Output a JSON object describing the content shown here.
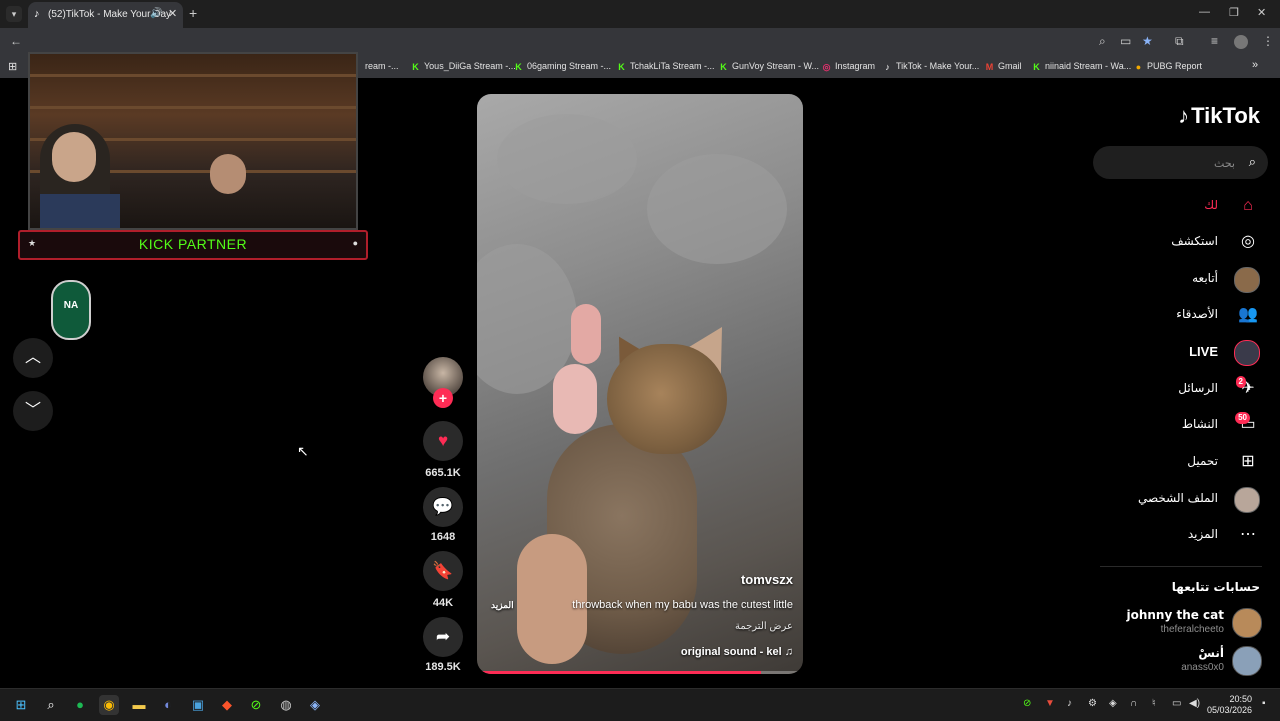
{
  "browser": {
    "tab_title": "(52)TikTok - Make Your Day",
    "new_tab": "+",
    "bookmarks": [
      {
        "label": "ream -...",
        "icon": "kick-icon"
      },
      {
        "label": "Yous_DiiGa Stream -...",
        "icon": "kick-icon"
      },
      {
        "label": "06gaming Stream -...",
        "icon": "kick-icon"
      },
      {
        "label": "TchakLiTa Stream -...",
        "icon": "kick-icon"
      },
      {
        "label": "GunVoy Stream - W...",
        "icon": "kick-icon"
      },
      {
        "label": "Instagram",
        "icon": "instagram-icon"
      },
      {
        "label": "TikTok - Make Your...",
        "icon": "tiktok-icon"
      },
      {
        "label": "Gmail",
        "icon": "gmail-icon"
      },
      {
        "label": "niinaid Stream - Wa...",
        "icon": "kick-icon"
      },
      {
        "label": "PUBG Report",
        "icon": "pubg-icon"
      }
    ]
  },
  "overlay": {
    "partner_label": "KICK PARTNER"
  },
  "video": {
    "username": "tomvszx",
    "description": "throwback when my babu was the cutest little",
    "more": "المزيد",
    "translate": "عرض الترجمة",
    "sound": "original sound - kel",
    "progress": 0.87
  },
  "actions": {
    "likes": "665.1K",
    "comments": "1648",
    "saves": "44K",
    "shares": "189.5K"
  },
  "sidebar": {
    "logo": "TikTok",
    "search_placeholder": "بحث",
    "nav": [
      {
        "label": "لك",
        "icon": "home-icon",
        "active": true
      },
      {
        "label": "استكشف",
        "icon": "compass-icon"
      },
      {
        "label": "أتابعه",
        "icon": "following-avatar"
      },
      {
        "label": "الأصدقاء",
        "icon": "friends-icon"
      },
      {
        "label": "LIVE",
        "icon": "live-avatar"
      },
      {
        "label": "الرسائل",
        "icon": "messages-icon",
        "badge": "2"
      },
      {
        "label": "النشاط",
        "icon": "activity-icon",
        "badge": "50"
      },
      {
        "label": "تحميل",
        "icon": "upload-icon"
      },
      {
        "label": "الملف الشخصي",
        "icon": "profile-avatar"
      },
      {
        "label": "المزيد",
        "icon": "more-icon"
      }
    ],
    "following_title": "حسابات تتابعها",
    "accounts": [
      {
        "name": "johnny the cat",
        "handle": "theferalcheeto"
      },
      {
        "name": "أنسْ",
        "handle": "anass0x0"
      }
    ]
  },
  "taskbar": {
    "time": "20:50",
    "date": "05/03/2026"
  },
  "colors": {
    "accent": "#fe2c55",
    "kick_green": "#53fc18"
  }
}
